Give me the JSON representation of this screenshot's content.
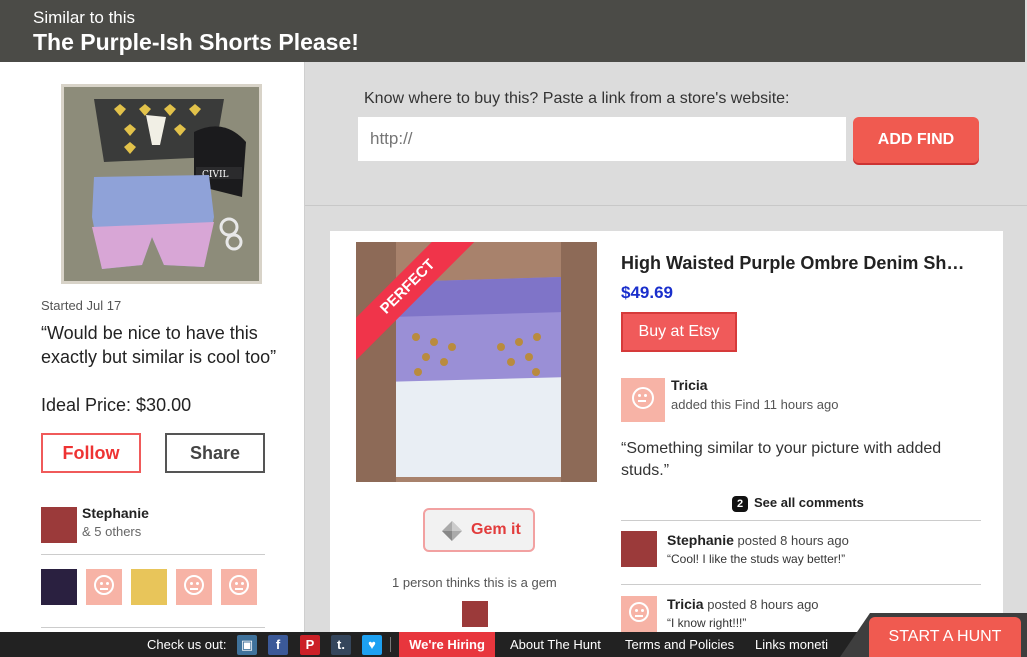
{
  "header": {
    "subtitle": "Similar to this",
    "title": "The Purple-Ish Shorts Please!"
  },
  "hunt": {
    "started": "Started Jul 17",
    "quote": "“Would be nice to have this exactly but similar is cool too”",
    "ideal_price": "Ideal Price: $30.00",
    "follow_label": "Follow",
    "share_label": "Share",
    "hunter_name": "Stephanie",
    "hunter_others": "& 5 others"
  },
  "add_find": {
    "label": "Know where to buy this? Paste a link from a store's website:",
    "placeholder": "http://",
    "button": "ADD FIND"
  },
  "find": {
    "ribbon": "PERFECT",
    "title": "High Waisted Purple Ombre Denim Sh…",
    "price": "$49.69",
    "buy_label": "Buy at Etsy",
    "gem_label": "Gem it",
    "gem_count": "1 person thinks this is a gem",
    "finder_name": "Tricia",
    "finder_action": "added this Find 11 hours ago",
    "finder_quote": "“Something similar to your picture with added studs.”",
    "see_all_count": "2",
    "see_all_label": "See all comments"
  },
  "comments": [
    {
      "name": "Stephanie",
      "meta": "posted 8 hours ago",
      "text": "“Cool! I like the studs way better!”"
    },
    {
      "name": "Tricia",
      "meta": "posted 8 hours ago",
      "text": "“I know right!!!”"
    }
  ],
  "footer": {
    "check_us_out": "Check us out:",
    "social": [
      {
        "icon": "instagram-icon",
        "glyph": "▣",
        "color": "#3f729b"
      },
      {
        "icon": "facebook-icon",
        "glyph": "f",
        "color": "#3b5998"
      },
      {
        "icon": "pinterest-icon",
        "glyph": "P",
        "color": "#cb2027"
      },
      {
        "icon": "tumblr-icon",
        "glyph": "t.",
        "color": "#35465c"
      },
      {
        "icon": "twitter-icon",
        "glyph": "♥",
        "color": "#1da1f2"
      }
    ],
    "hiring": "We're Hiring",
    "about": "About The Hunt",
    "terms": "Terms and Policies",
    "links": "Links moneti",
    "start_hunt": "START A HUNT"
  },
  "colors": {
    "accent": "#f05a50",
    "topbar": "#4b4b47",
    "price": "#1a2fcc"
  }
}
